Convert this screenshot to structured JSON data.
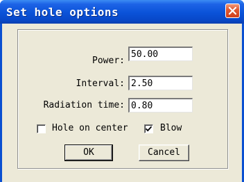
{
  "dialog": {
    "title": "Set hole options",
    "close_icon": "close-icon",
    "close_color": "#d2401a",
    "titlebar_color": "#0a52d8"
  },
  "fields": [
    {
      "label": "Power:",
      "value": "50.00"
    },
    {
      "label": "Interval:",
      "value": "2.50"
    },
    {
      "label": "Radiation time:",
      "value": "0.80"
    }
  ],
  "options": {
    "hole_on_center": {
      "label": "Hole on center",
      "checked": false
    },
    "blow": {
      "label": "Blow",
      "checked": true
    }
  },
  "buttons": {
    "ok_label": "OK",
    "cancel_label": "Cancel"
  }
}
